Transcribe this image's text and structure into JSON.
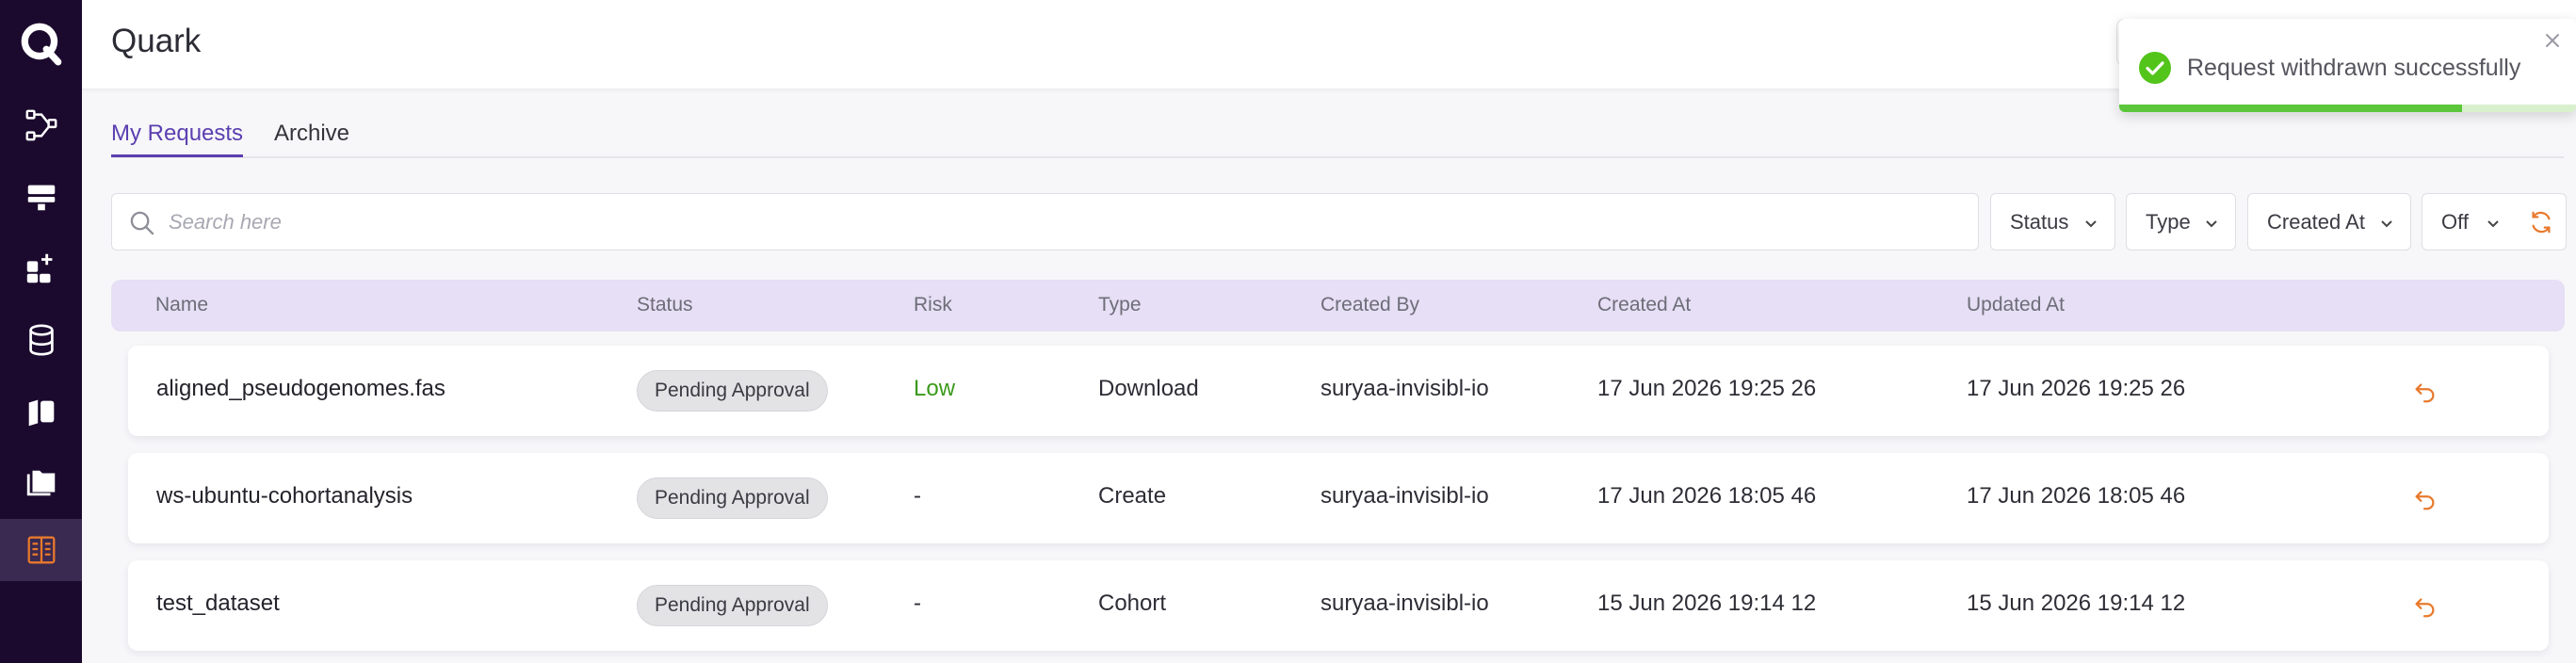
{
  "app": {
    "title": "Quark"
  },
  "sidebar": {
    "items": [
      {
        "icon": "workflow-icon"
      },
      {
        "icon": "server-icon"
      },
      {
        "icon": "apps-add-icon"
      },
      {
        "icon": "database-icon"
      },
      {
        "icon": "cohort-icon"
      },
      {
        "icon": "folders-icon"
      },
      {
        "icon": "requests-icon",
        "active": true
      }
    ]
  },
  "tabs": [
    {
      "label": "My Requests",
      "active": true
    },
    {
      "label": "Archive",
      "active": false
    }
  ],
  "search": {
    "placeholder": "Search here",
    "value": ""
  },
  "filters": {
    "status": "Status",
    "type": "Type",
    "created_at": "Created At",
    "auto_refresh": "Off"
  },
  "table": {
    "columns": [
      "Name",
      "Status",
      "Risk",
      "Type",
      "Created By",
      "Created At",
      "Updated At"
    ],
    "rows": [
      {
        "name": "aligned_pseudogenomes.fas",
        "status": "Pending Approval",
        "risk": "Low",
        "type": "Download",
        "created_by": "suryaa-invisibl-io",
        "created_at": "17 Jun 2026 19:25 26",
        "updated_at": "17 Jun 2026 19:25 26"
      },
      {
        "name": "ws-ubuntu-cohortanalysis",
        "status": "Pending Approval",
        "risk": "-",
        "type": "Create",
        "created_by": "suryaa-invisibl-io",
        "created_at": "17 Jun 2026 18:05 46",
        "updated_at": "17 Jun 2026 18:05 46"
      },
      {
        "name": "test_dataset",
        "status": "Pending Approval",
        "risk": "-",
        "type": "Cohort",
        "created_by": "suryaa-invisibl-io",
        "created_at": "15 Jun 2026 19:14 12",
        "updated_at": "15 Jun 2026 19:14 12"
      }
    ]
  },
  "toast": {
    "message": "Request withdrawn successfully",
    "progress": 0.75
  },
  "colors": {
    "sidebar_bg": "#1b0a2e",
    "accent": "#5b3fb0",
    "refresh": "#e8792c",
    "success": "#5bc63a",
    "risk_low": "#3a9a1a",
    "table_header_bg": "#e6dff5"
  }
}
